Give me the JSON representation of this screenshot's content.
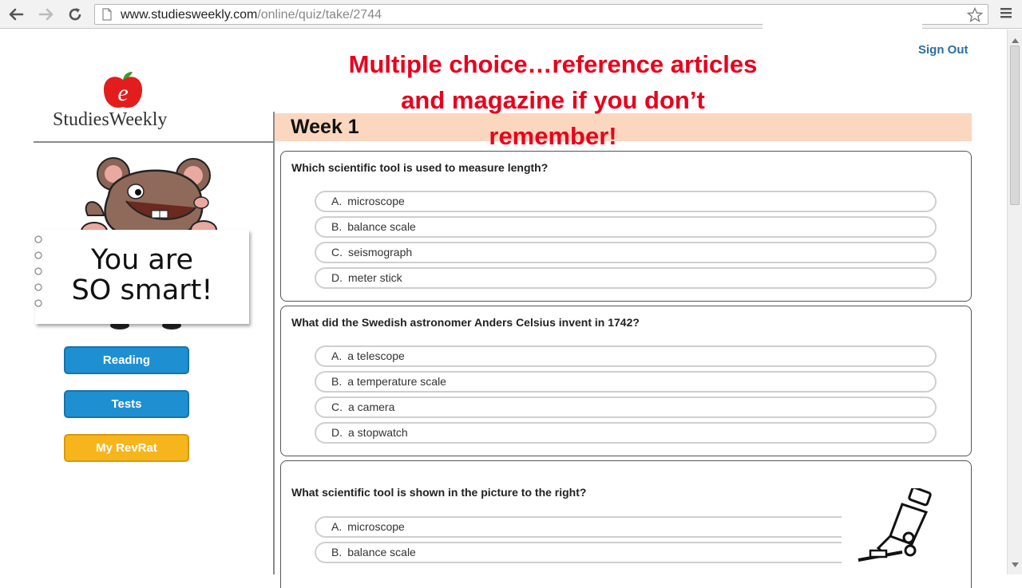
{
  "browser": {
    "url_host": "www.studiesweekly.com",
    "url_path": "/online/quiz/take/2744",
    "back_icon": "back-arrow-icon",
    "forward_icon": "forward-arrow-icon",
    "reload_icon": "reload-icon",
    "page_icon": "page-icon",
    "star_icon": "star-icon",
    "menu_icon": "menu-icon"
  },
  "header": {
    "sign_out_label": "Sign Out",
    "annotation_lines": [
      "Multiple choice…reference articles",
      "and magazine if you don’t",
      "remember!"
    ]
  },
  "logo": {
    "text": "StudiesWeekly",
    "letter": "e"
  },
  "mascot": {
    "sign_line1": "You are",
    "sign_line2": "SO smart!"
  },
  "sidebar": {
    "buttons": [
      {
        "label": "Reading",
        "color": "#1e90d2"
      },
      {
        "label": "Tests",
        "color": "#1e90d2"
      },
      {
        "label": "My RevRat",
        "color": "#f7b51d"
      }
    ]
  },
  "quiz": {
    "week_title": "Week 1",
    "questions": [
      {
        "text": "Which scientific tool is used to measure length?",
        "options": [
          {
            "letter": "A.",
            "text": "microscope"
          },
          {
            "letter": "B.",
            "text": "balance scale"
          },
          {
            "letter": "C.",
            "text": "seismograph"
          },
          {
            "letter": "D.",
            "text": "meter stick"
          }
        ]
      },
      {
        "text": "What did the Swedish astronomer Anders Celsius invent in 1742?",
        "options": [
          {
            "letter": "A.",
            "text": "a telescope"
          },
          {
            "letter": "B.",
            "text": "a temperature scale"
          },
          {
            "letter": "C.",
            "text": "a camera"
          },
          {
            "letter": "D.",
            "text": "a stopwatch"
          }
        ]
      },
      {
        "text": "What scientific tool is shown in the picture to the right?",
        "options": [
          {
            "letter": "A.",
            "text": "microscope"
          },
          {
            "letter": "B.",
            "text": "balance scale"
          }
        ]
      }
    ]
  },
  "colors": {
    "week_bar": "#fcd7bf",
    "annotation": "#e8001c",
    "link": "#2a6ea6"
  }
}
